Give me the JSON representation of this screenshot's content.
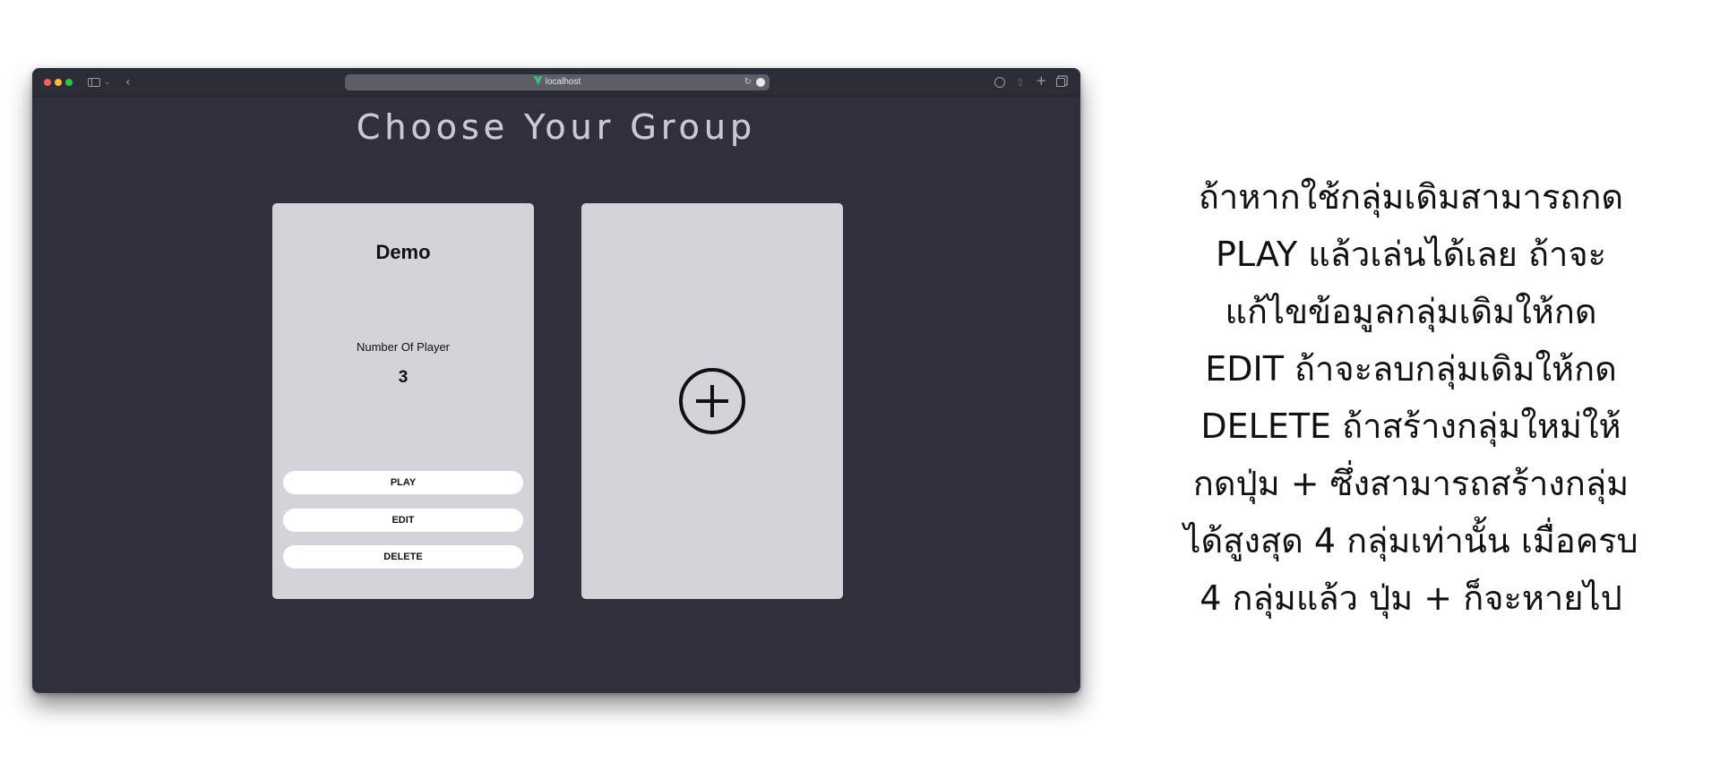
{
  "browser": {
    "url": "localhost",
    "icons": [
      "close-dot",
      "minimize-dot",
      "zoom-dot",
      "sidebar-icon",
      "chevron-down-icon",
      "back-icon",
      "vue-logo-icon",
      "reload-icon",
      "more-icon",
      "download-icon",
      "share-icon",
      "plus-icon",
      "tabs-icon"
    ],
    "glyphs": {
      "chevron": "⌄",
      "back": "‹",
      "reload": "↻",
      "share": "⇧",
      "newtab": "+"
    },
    "colors": {
      "red": "#ff5f57",
      "yellow": "#febc2e",
      "green": "#28c840",
      "vue": "#42b883"
    }
  },
  "page": {
    "title": "Choose Your Group",
    "background": "#2e313b",
    "card_color": "#d2d4d9"
  },
  "groups": [
    {
      "name": "Demo",
      "players_label": "Number Of Player",
      "players": "3",
      "buttons": {
        "play": "PLAY",
        "edit": "EDIT",
        "delete": "DELETE"
      }
    }
  ],
  "add_card": {
    "icon": "plus-circle-icon"
  },
  "instructions": {
    "lines": [
      "ถ้าหากใช้กลุ่มเดิมสามารถกด",
      "PLAY แล้วเล่นได้เลย ถ้าจะ",
      "แก้ไขข้อมูลกลุ่มเดิมให้กด",
      "EDIT ถ้าจะลบกลุ่มเดิมให้กด",
      "DELETE ถ้าสร้างกลุ่มใหม่ให้",
      "กดปุ่ม + ซึ่งสามารถสร้างกลุ่ม",
      "ได้สูงสุด 4 กลุ่มเท่านั้น เมื่อครบ",
      "4 กลุ่มแล้ว ปุ่ม + ก็จะหายไป"
    ]
  }
}
